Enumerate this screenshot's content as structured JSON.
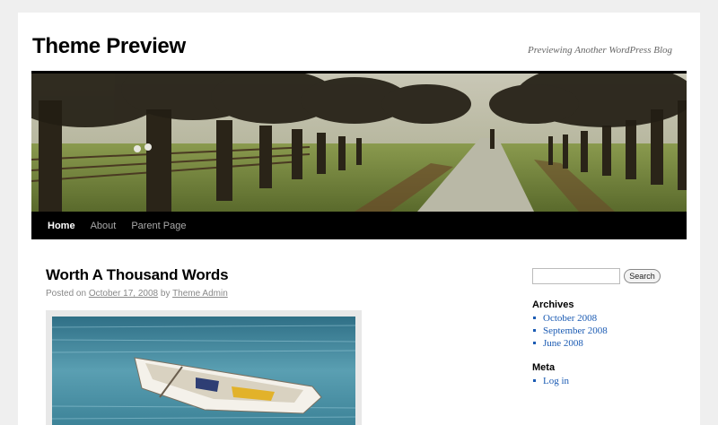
{
  "site": {
    "title": "Theme Preview",
    "description": "Previewing Another WordPress Blog"
  },
  "nav": {
    "items": [
      {
        "label": "Home",
        "current": true
      },
      {
        "label": "About",
        "current": false
      },
      {
        "label": "Parent Page",
        "current": false
      }
    ]
  },
  "post": {
    "title": "Worth A Thousand Words",
    "posted_on": "Posted on",
    "date": "October 17, 2008",
    "by": "by",
    "author": "Theme Admin"
  },
  "sidebar": {
    "search": {
      "value": "",
      "button_label": "Search"
    },
    "archives": {
      "title": "Archives",
      "items": [
        "October 2008",
        "September 2008",
        "June 2008"
      ]
    },
    "meta": {
      "title": "Meta",
      "items": [
        "Log in"
      ]
    }
  },
  "colors": {
    "link": "#1b5bb3",
    "nav_bg": "#000000",
    "page_bg": "#efefef"
  }
}
